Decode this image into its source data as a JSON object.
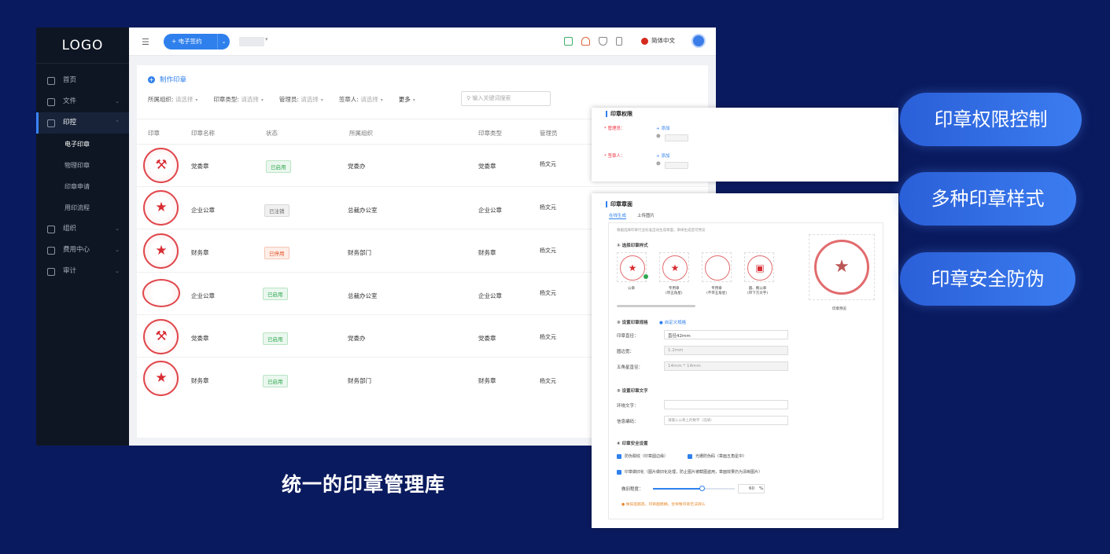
{
  "sidebar": {
    "logo": "LOGO",
    "items": [
      {
        "label": "首页",
        "icon": "home-icon"
      },
      {
        "label": "文件",
        "icon": "file-icon"
      },
      {
        "label": "印控",
        "icon": "seal-icon"
      },
      {
        "label": "组织",
        "icon": "team-icon"
      },
      {
        "label": "费用中心",
        "icon": "billing-icon"
      },
      {
        "label": "审计",
        "icon": "audit-icon"
      }
    ],
    "sub_items": [
      "电子印章",
      "物理印章",
      "印章申请",
      "用印流程"
    ]
  },
  "header": {
    "new_button": "+ 电子签约",
    "language": "简体中文"
  },
  "main": {
    "make_seal": "制作印章",
    "filters": [
      {
        "label": "所属组织:",
        "placeholder": "请选择"
      },
      {
        "label": "印章类型:",
        "placeholder": "请选择"
      },
      {
        "label": "管理员:",
        "placeholder": "请选择"
      },
      {
        "label": "签章人:",
        "placeholder": "请选择"
      }
    ],
    "more": "更多",
    "search_placeholder": "输入关键词搜索",
    "columns": [
      "印章",
      "印章名称",
      "状态",
      "所属组织",
      "印章类型",
      "管理员"
    ],
    "rows": [
      {
        "name": "党委章",
        "status": "已启用",
        "org": "党委办",
        "type": "党委章",
        "admin": "杨文元"
      },
      {
        "name": "企业公章",
        "status": "已注销",
        "org": "总裁办公室",
        "type": "企业公章",
        "admin": "杨文元"
      },
      {
        "name": "财务章",
        "status": "已停用",
        "org": "财务部门",
        "type": "财务章",
        "admin": "杨文元"
      },
      {
        "name": "企业公章",
        "status": "已启用",
        "org": "总裁办公室",
        "type": "企业公章",
        "admin": "杨文元"
      },
      {
        "name": "党委章",
        "status": "已启用",
        "org": "党委办",
        "type": "党委章",
        "admin": "杨文元"
      },
      {
        "name": "财务章",
        "status": "已启用",
        "org": "财务部门",
        "type": "财务章",
        "admin": "杨文元"
      }
    ]
  },
  "permission_panel": {
    "title": "印章权限",
    "admin_label": "* 管理员：",
    "signer_label": "* 签章人：",
    "add": "+ 添加"
  },
  "style_panel": {
    "title": "印章章面",
    "tabs": [
      "在线生成",
      "上传图片"
    ],
    "tip": "根据选择印章行业标准自动生成章面，章样生成后可预览",
    "section1": "① 选择印章样式",
    "samples": [
      {
        "label": "公章"
      },
      {
        "label": "专用章\n(带五角星)"
      },
      {
        "label": "专用章\n(不带五角星)"
      },
      {
        "label": "圆、椭公章\n(带下方文字)"
      }
    ],
    "preview_label": "印章预览",
    "section2": "② 设置印章规格",
    "custom_spec": "自定义规格",
    "diameter_label": "印章直径：",
    "diameter_value": "直径42mm",
    "border_label": "圆边宽：",
    "border_value": "1.2mm",
    "star_label": "五角星直径：",
    "star_value": "14mm * 14mm",
    "section3": "③ 设置印章文字",
    "ring_label": "环绕文字：",
    "code_label": "信息编码：",
    "code_placeholder": "请输入公章上的数字（选填）",
    "section4": "④ 印章安全设置",
    "anti_crack": "防伪裂纹（印章圆边缘）",
    "anti_light": "光栅防伪码（章面五角星中）",
    "aging": "印章做旧化（图片做旧化处理，防止图片被截图盗用，章面效果仍为清晰图片）",
    "aging_degree_label": "做旧程度：",
    "aging_percent": 60,
    "aging_value": "60",
    "percent_sign": "%",
    "warning": "做旧度越高，印章越模糊，会导致印章无法辨认"
  },
  "features": [
    "印章权限控制",
    "多种印章样式",
    "印章安全防伪"
  ],
  "caption": "统一的印章管理库",
  "colors": {
    "background": "#0a1a5e",
    "accent": "#2f80ed",
    "seal_red": "#d82c33"
  }
}
